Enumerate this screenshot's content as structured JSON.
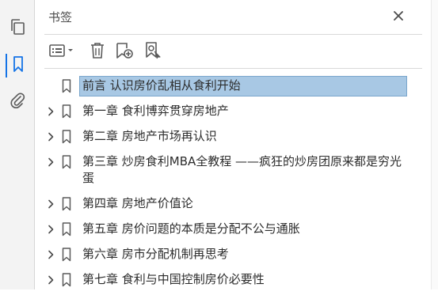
{
  "panel": {
    "title": "书签"
  },
  "bookmarks": [
    {
      "label": "前言  认识房价乱相从食利开始",
      "expandable": false,
      "selected": true
    },
    {
      "label": "第一章  食利博弈贯穿房地产",
      "expandable": true,
      "selected": false
    },
    {
      "label": "第二章  房地产市场再认识",
      "expandable": true,
      "selected": false
    },
    {
      "label": "第三章  炒房食利MBA全教程 ——疯狂的炒房团原来都是穷光蛋",
      "expandable": true,
      "selected": false
    },
    {
      "label": "第四章  房地产价值论",
      "expandable": true,
      "selected": false
    },
    {
      "label": "第五章  房价问题的本质是分配不公与通胀",
      "expandable": true,
      "selected": false
    },
    {
      "label": "第六章  房市分配机制再思考",
      "expandable": true,
      "selected": false
    },
    {
      "label": "第七章  食利与中国控制房价必要性",
      "expandable": true,
      "selected": false
    }
  ],
  "colors": {
    "accent": "#1473e6",
    "selection": "#a8c8e4",
    "icon": "#5a5a5a"
  },
  "icons": {
    "rail": [
      "pages-icon",
      "bookmark-icon",
      "attachment-icon"
    ],
    "toolbar": [
      "options-menu-icon",
      "delete-icon",
      "new-bookmark-icon",
      "search-bookmark-icon"
    ]
  }
}
